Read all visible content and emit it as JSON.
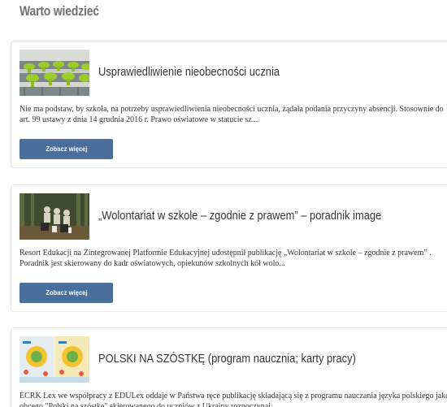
{
  "section": {
    "title": "Warto wiedzieć"
  },
  "articles": [
    {
      "title": "Usprawiedliwienie nieobecności ucznia",
      "description": "Nie ma podstaw, by szkoła, na potrzeby usprawiedliwienia nieobecności ucznia, żądała podania przyczyny absencji. Stosownie do art. 99 ustawy z dnia 14 grudnia 2016 r. Prawo oświatowe w statucie sz...",
      "button_label": "Zobacz więcej",
      "image": "classroom-chairs-photo"
    },
    {
      "title": "„Wolontariat w szkole – zgodnie z prawem” – poradnik image",
      "description": "Resort Edukacji na Zintegrowanej Platformie Edukacyjnej udostępnił publikację „Wolontariat w szkole – zgodnie z prawem” . Poradnik jest skierowany do kadr oświatowych, opiekunów szkolnych kół wolo...",
      "button_label": "Zobacz więcej",
      "image": "volunteers-forest-photo"
    },
    {
      "title": "POLSKI NA SZÓSTKĘ (program naucznia; karty pracy)",
      "description": "ECRK Lex we współpracy z EDULex oddaje w Państwa ręce publikację składającą się z programu nauczania języka polskiego jako obcego \"Polski na szóstkę\" skierowanego do uczniów z Ukrainy rozpoczynaj...",
      "button_label": "Zobacz więcej",
      "image": "book-covers-illustration"
    }
  ],
  "colors": {
    "button": "#4a6f9c",
    "title": "#6f6f6f",
    "border": "#e6e6e6"
  }
}
